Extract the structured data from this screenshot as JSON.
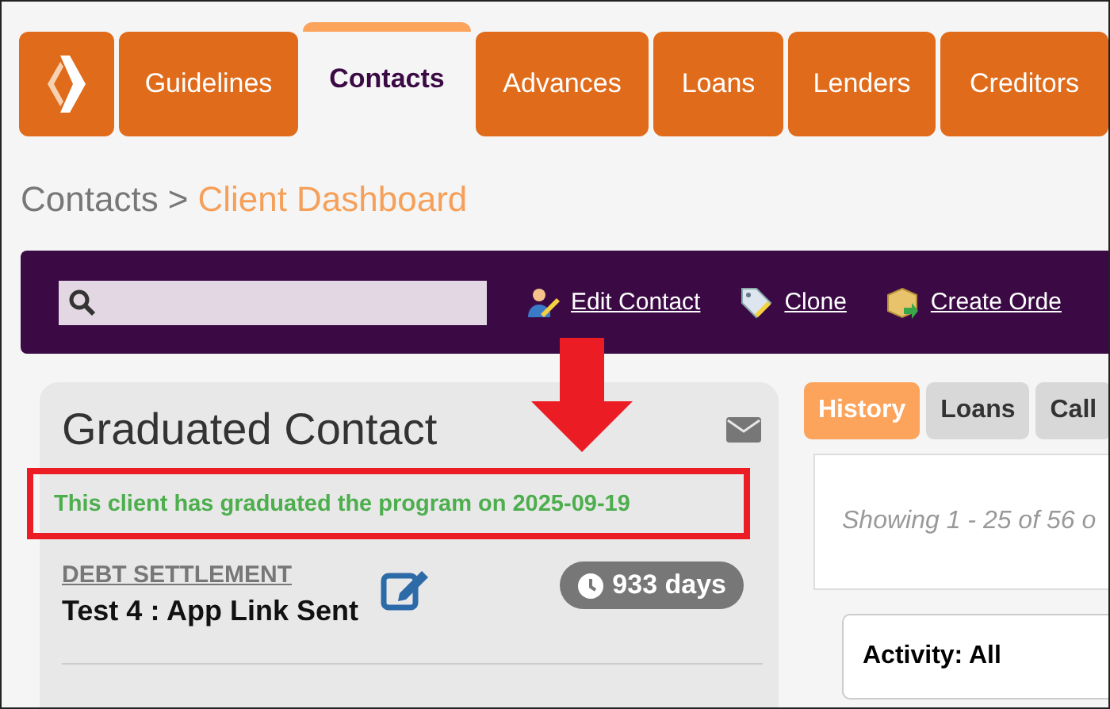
{
  "nav_tabs": [
    {
      "label": "Guidelines",
      "selected": false
    },
    {
      "label": "Contacts",
      "selected": true
    },
    {
      "label": "Advances",
      "selected": false
    },
    {
      "label": "Loans",
      "selected": false
    },
    {
      "label": "Lenders",
      "selected": false
    },
    {
      "label": "Creditors",
      "selected": false
    }
  ],
  "breadcrumb": {
    "parent": "Contacts",
    "separator": ">",
    "current": "Client Dashboard"
  },
  "toolbar": {
    "links": [
      "Edit Contact",
      "Clone",
      "Create Orde"
    ]
  },
  "contact_card": {
    "title": "Graduated Contact",
    "notice": "This client has graduated the program on 2025-09-19",
    "program": "DEBT SETTLEMENT",
    "status": "Test 4 : App Link Sent",
    "duration": "933 days"
  },
  "side_tabs": [
    {
      "label": "History",
      "selected": true
    },
    {
      "label": "Loans",
      "selected": false
    },
    {
      "label": "Call",
      "selected": false
    }
  ],
  "history": {
    "showing": "Showing 1 - 25 of 56 o",
    "filter": "Activity: All"
  }
}
